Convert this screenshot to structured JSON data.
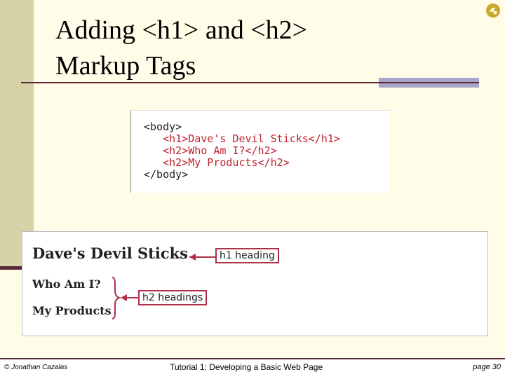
{
  "slide": {
    "title_line1": "Adding <h1> and <h2>",
    "title_line2": "Markup Tags"
  },
  "code": {
    "lines": [
      {
        "text": "<body>",
        "color": "#222222"
      },
      {
        "text": "   <h1>Dave's Devil Sticks</h1>",
        "color": "#c0212f"
      },
      {
        "text": "   <h2>Who Am I?</h2>",
        "color": "#c0212f"
      },
      {
        "text": "   <h2>My Products</h2>",
        "color": "#c0212f"
      },
      {
        "text": "</body>",
        "color": "#222222"
      }
    ]
  },
  "rendered": {
    "h1_text": "Dave's Devil Sticks",
    "h2_text_1": "Who Am I?",
    "h2_text_2": "My Products",
    "callout_h1": "h1 heading",
    "callout_h2": "h2 headings",
    "annotation_color": "#b0304a"
  },
  "footer": {
    "copyright": "© Jonathan Cazalas",
    "center": "Tutorial 1: Developing a Basic Web Page",
    "page": "page 30"
  },
  "icons": {
    "logo": "logo-icon"
  }
}
